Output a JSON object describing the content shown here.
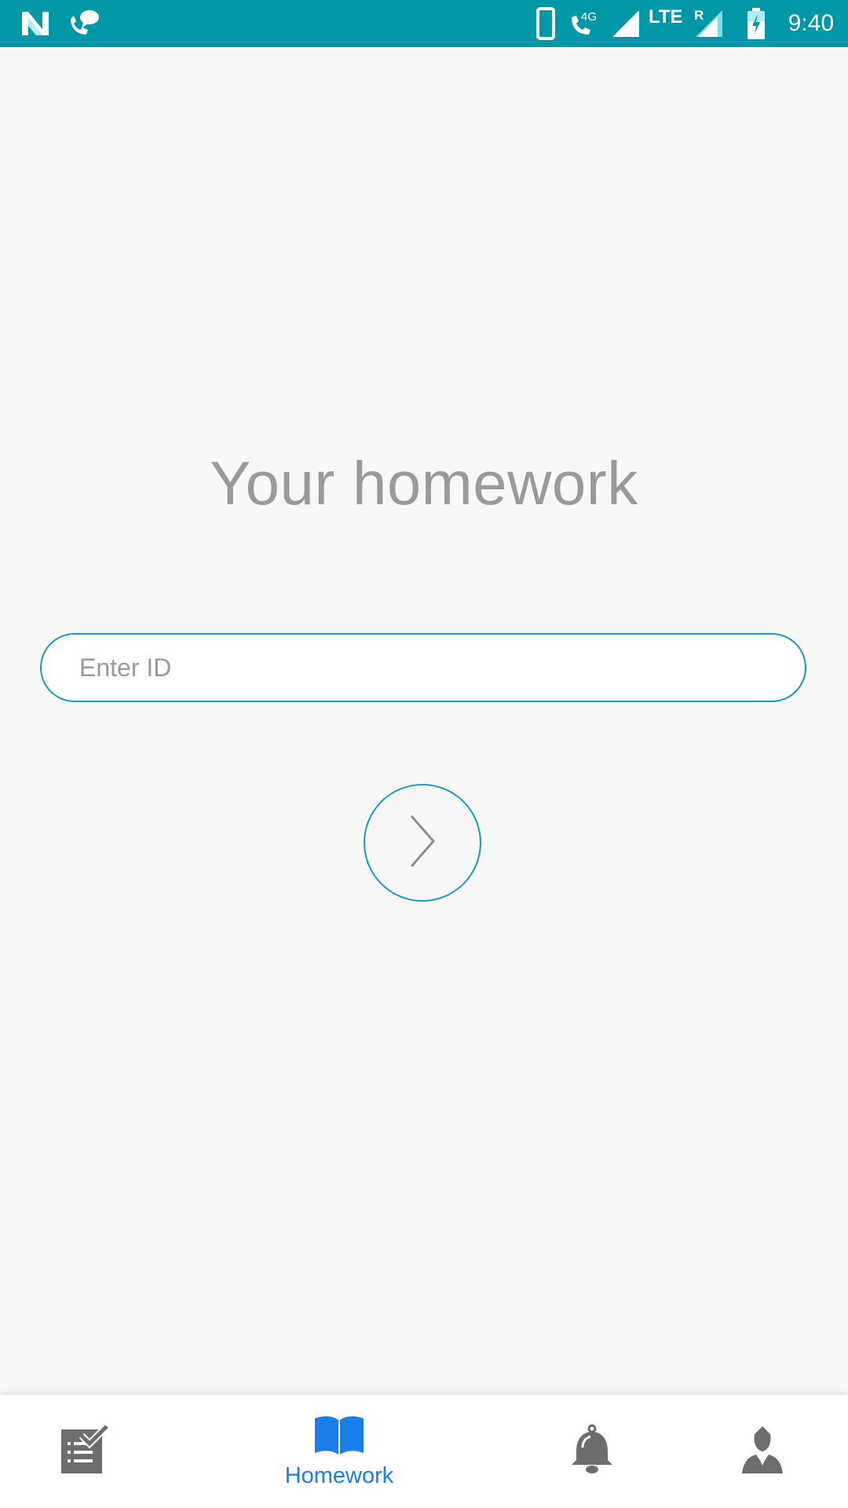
{
  "status_bar": {
    "time": "9:40",
    "network_4g": "4G",
    "network_lte": "LTE",
    "roaming": "R",
    "background_color": "#0097a7",
    "icons": [
      "n-logo-icon",
      "call-chat-icon",
      "phone-device-icon",
      "wifi-calling-icon",
      "signal-icon",
      "signal-roaming-icon",
      "battery-charging-icon"
    ]
  },
  "main": {
    "title": "Your homework",
    "id_input": {
      "value": "",
      "placeholder": "Enter ID"
    },
    "submit_icon": "chevron-right-icon",
    "accent_color": "#1a9bc2"
  },
  "bottom_nav": {
    "items": [
      {
        "icon": "checklist-icon",
        "label": "",
        "active": false
      },
      {
        "icon": "open-book-icon",
        "label": "Homework",
        "active": true
      },
      {
        "icon": "bell-icon",
        "label": "",
        "active": false
      },
      {
        "icon": "person-icon",
        "label": "",
        "active": false
      }
    ],
    "active_color": "#1a7ee8",
    "inactive_color": "#6d6d6d"
  }
}
